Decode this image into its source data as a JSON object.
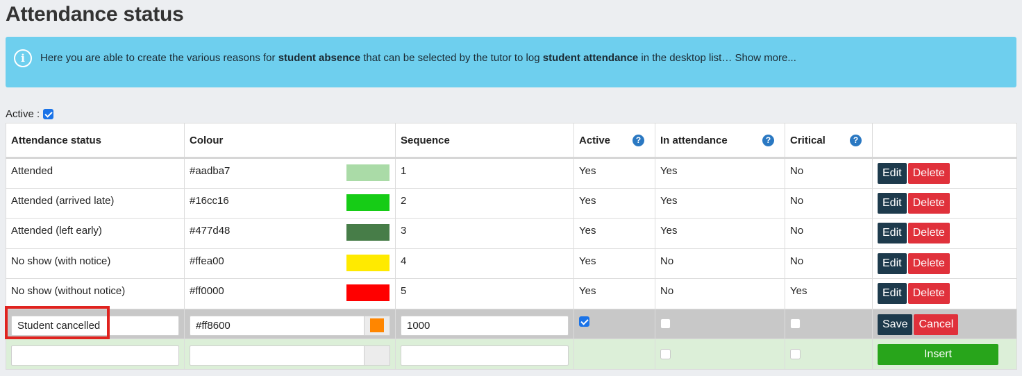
{
  "page": {
    "title": "Attendance status"
  },
  "info": {
    "text_1": "Here you are able to create the various reasons for ",
    "bold_1": "student absence",
    "text_2": " that can be selected by the tutor to log ",
    "bold_2": "student attendance",
    "text_3": " in the desktop list… Show more..."
  },
  "filter": {
    "active_label": "Active :",
    "active_checked": true
  },
  "table": {
    "headers": {
      "status": "Attendance status",
      "colour": "Colour",
      "sequence": "Sequence",
      "active": "Active",
      "in_attendance": "In attendance",
      "critical": "Critical"
    },
    "rows": [
      {
        "status": "Attended",
        "colour": "#aadba7",
        "sequence": "1",
        "active": "Yes",
        "in_attendance": "Yes",
        "critical": "No"
      },
      {
        "status": "Attended (arrived late)",
        "colour": "#16cc16",
        "sequence": "2",
        "active": "Yes",
        "in_attendance": "Yes",
        "critical": "No"
      },
      {
        "status": "Attended (left early)",
        "colour": "#477d48",
        "sequence": "3",
        "active": "Yes",
        "in_attendance": "Yes",
        "critical": "No"
      },
      {
        "status": "No show (with notice)",
        "colour": "#ffea00",
        "sequence": "4",
        "active": "Yes",
        "in_attendance": "No",
        "critical": "No"
      },
      {
        "status": "No show (without notice)",
        "colour": "#ff0000",
        "sequence": "5",
        "active": "Yes",
        "in_attendance": "No",
        "critical": "Yes"
      }
    ],
    "edit_label": "Edit",
    "delete_label": "Delete"
  },
  "edit_row": {
    "status": "Student cancelled",
    "colour": "#ff8600",
    "sequence": "1000",
    "active": true,
    "in_attendance": false,
    "critical": false,
    "save_label": "Save",
    "cancel_label": "Cancel"
  },
  "insert_row": {
    "status": "",
    "colour": "",
    "sequence": "",
    "in_attendance": false,
    "critical": false,
    "insert_label": "Insert"
  },
  "colors": {
    "info_bg": "#6ecfee",
    "edit_button": "#1d3a4c",
    "delete_button": "#e0313b",
    "insert_button": "#28a51b",
    "highlight": "#e0231f"
  },
  "icons": {
    "info": "info-icon",
    "help": "question-circle-icon"
  }
}
